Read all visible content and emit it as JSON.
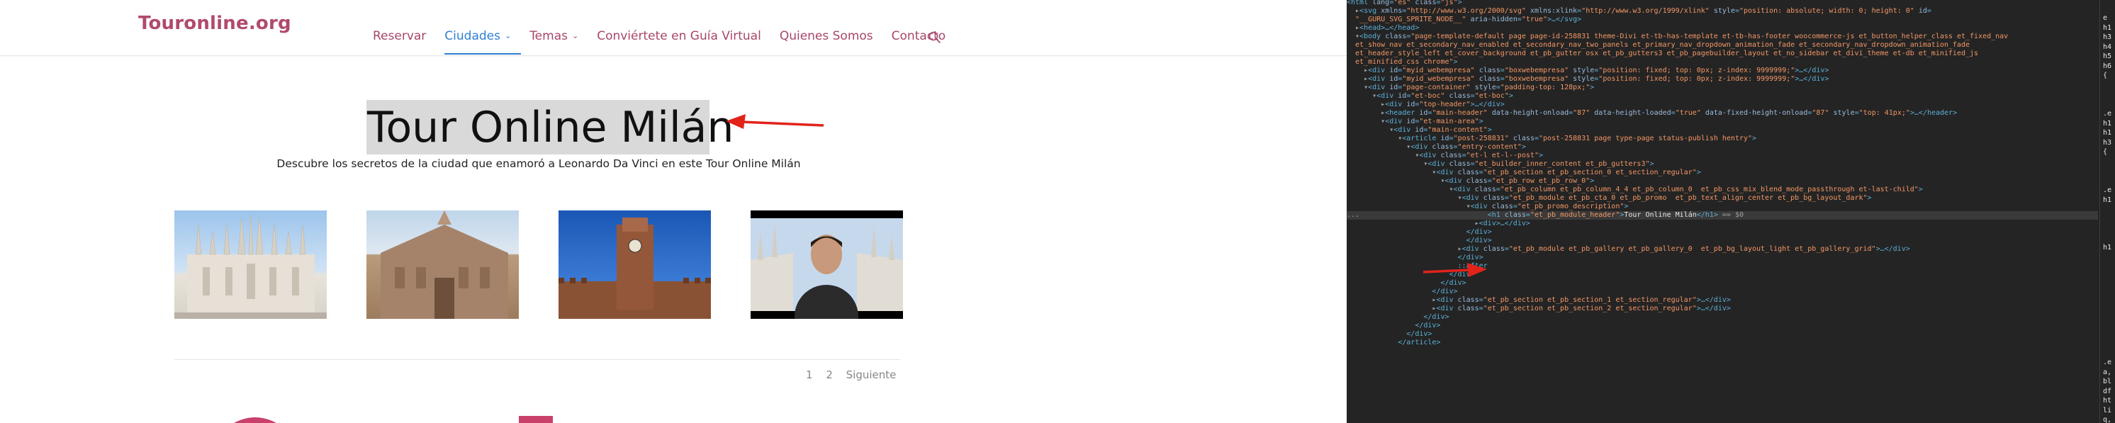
{
  "site": {
    "logo": "Touronline.org",
    "nav": [
      {
        "label": "Reservar",
        "dropdown": false
      },
      {
        "label": "Ciudades",
        "dropdown": true,
        "active": true
      },
      {
        "label": "Temas",
        "dropdown": true
      },
      {
        "label": "Conviértete en Guía Virtual",
        "dropdown": false
      },
      {
        "label": "Quienes Somos",
        "dropdown": false
      },
      {
        "label": "Contacto",
        "dropdown": false
      }
    ],
    "caret": "⌄",
    "hero_title": "Tour Online Milán",
    "hero_subtitle": "Descubre los secretos de la ciudad que enamoró a Leonardo Da Vinci en este Tour Online Milán",
    "pagination": {
      "pages": [
        "1",
        "2"
      ],
      "next": "Siguiente"
    },
    "colors": {
      "brand": "#b04a6e",
      "nav_active": "#2f7fd3",
      "arrow": "#e2231a"
    }
  },
  "devtools": {
    "lines": [
      [
        [
          "t",
          "<html "
        ],
        [
          "a",
          "lang"
        ],
        [
          "t",
          "="
        ],
        [
          "v",
          "\"es\""
        ],
        [
          "t",
          " "
        ],
        [
          "a",
          "class"
        ],
        [
          "t",
          "="
        ],
        [
          "v",
          "\"js\""
        ],
        [
          "t",
          ">"
        ]
      ],
      [
        [
          "r",
          "  ▸"
        ],
        [
          "t",
          "<svg "
        ],
        [
          "a",
          "xmlns"
        ],
        [
          "t",
          "="
        ],
        [
          "v",
          "\"http://www.w3.org/2000/svg\""
        ],
        [
          "t",
          " "
        ],
        [
          "a",
          "xmlns:xlink"
        ],
        [
          "t",
          "="
        ],
        [
          "v",
          "\"http://www.w3.org/1999/xlink\""
        ],
        [
          "t",
          " "
        ],
        [
          "a",
          "style"
        ],
        [
          "t",
          "="
        ],
        [
          "v",
          "\"position: absolute; width: 0; height: 0\""
        ],
        [
          "t",
          " "
        ],
        [
          "a",
          "id"
        ],
        [
          "t",
          "="
        ]
      ],
      [
        [
          "t",
          "  "
        ],
        [
          "v",
          "\"__GURU_SVG_SPRITE_NODE__\""
        ],
        [
          "t",
          " "
        ],
        [
          "a",
          "aria-hidden"
        ],
        [
          "t",
          "="
        ],
        [
          "v",
          "\"true\""
        ],
        [
          "t",
          ">…</svg>"
        ]
      ],
      [
        [
          "r",
          "  ▸"
        ],
        [
          "t",
          "<head>…</head>"
        ]
      ],
      [
        [
          "r",
          "  ▾"
        ],
        [
          "t",
          "<body "
        ],
        [
          "a",
          "class"
        ],
        [
          "t",
          "="
        ],
        [
          "v",
          "\"page-template-default page page-id-258831 theme-Divi et-tb-has-template et-tb-has-footer woocommerce-js et_button_helper_class et_fixed_nav"
        ]
      ],
      [
        [
          "v",
          "  et_show_nav et_secondary_nav_enabled et_secondary_nav_two_panels et_primary_nav_dropdown_animation_fade et_secondary_nav_dropdown_animation_fade"
        ]
      ],
      [
        [
          "v",
          "  et_header_style_left et_cover_background et_pb_gutter osx et_pb_gutters3 et_pb_pagebuilder_layout et_no_sidebar et_divi_theme et-db et_minified_js"
        ]
      ],
      [
        [
          "v",
          "  et_minified_css chrome\""
        ],
        [
          "t",
          ">"
        ]
      ],
      [
        [
          "r",
          "    ▸"
        ],
        [
          "t",
          "<div "
        ],
        [
          "a",
          "id"
        ],
        [
          "t",
          "="
        ],
        [
          "v",
          "\"myid_webempresa\""
        ],
        [
          "t",
          " "
        ],
        [
          "a",
          "class"
        ],
        [
          "t",
          "="
        ],
        [
          "v",
          "\"boxwebempresa\""
        ],
        [
          "t",
          " "
        ],
        [
          "a",
          "style"
        ],
        [
          "t",
          "="
        ],
        [
          "v",
          "\"position: fixed; top: 0px; z-index: 9999999;\""
        ],
        [
          "t",
          ">…</div>"
        ]
      ],
      [
        [
          "r",
          "    ▸"
        ],
        [
          "t",
          "<div "
        ],
        [
          "a",
          "id"
        ],
        [
          "t",
          "="
        ],
        [
          "v",
          "\"myid_webempresa\""
        ],
        [
          "t",
          " "
        ],
        [
          "a",
          "class"
        ],
        [
          "t",
          "="
        ],
        [
          "v",
          "\"boxwebempresa\""
        ],
        [
          "t",
          " "
        ],
        [
          "a",
          "style"
        ],
        [
          "t",
          "="
        ],
        [
          "v",
          "\"position: fixed; top: 0px; z-index: 9999999;\""
        ],
        [
          "t",
          ">…</div>"
        ]
      ],
      [
        [
          "r",
          "    ▾"
        ],
        [
          "t",
          "<div "
        ],
        [
          "a",
          "id"
        ],
        [
          "t",
          "="
        ],
        [
          "v",
          "\"page-container\""
        ],
        [
          "t",
          " "
        ],
        [
          "a",
          "style"
        ],
        [
          "t",
          "="
        ],
        [
          "v",
          "\"padding-top: 128px;\""
        ],
        [
          "t",
          ">"
        ]
      ],
      [
        [
          "r",
          "      ▾"
        ],
        [
          "t",
          "<div "
        ],
        [
          "a",
          "id"
        ],
        [
          "t",
          "="
        ],
        [
          "v",
          "\"et-boc\""
        ],
        [
          "t",
          " "
        ],
        [
          "a",
          "class"
        ],
        [
          "t",
          "="
        ],
        [
          "v",
          "\"et-boc\""
        ],
        [
          "t",
          ">"
        ]
      ],
      [
        [
          "r",
          "        ▸"
        ],
        [
          "t",
          "<div "
        ],
        [
          "a",
          "id"
        ],
        [
          "t",
          "="
        ],
        [
          "v",
          "\"top-header\""
        ],
        [
          "t",
          ">…</div>"
        ]
      ],
      [
        [
          "r",
          "        ▸"
        ],
        [
          "t",
          "<header "
        ],
        [
          "a",
          "id"
        ],
        [
          "t",
          "="
        ],
        [
          "v",
          "\"main-header\""
        ],
        [
          "t",
          " "
        ],
        [
          "a",
          "data-height-onload"
        ],
        [
          "t",
          "="
        ],
        [
          "v",
          "\"87\""
        ],
        [
          "t",
          " "
        ],
        [
          "a",
          "data-height-loaded"
        ],
        [
          "t",
          "="
        ],
        [
          "v",
          "\"true\""
        ],
        [
          "t",
          " "
        ],
        [
          "a",
          "data-fixed-height-onload"
        ],
        [
          "t",
          "="
        ],
        [
          "v",
          "\"87\""
        ],
        [
          "t",
          " "
        ],
        [
          "a",
          "style"
        ],
        [
          "t",
          "="
        ],
        [
          "v",
          "\"top: 41px;\""
        ],
        [
          "t",
          ">…</header>"
        ]
      ],
      [
        [
          "r",
          "        ▾"
        ],
        [
          "t",
          "<div "
        ],
        [
          "a",
          "id"
        ],
        [
          "t",
          "="
        ],
        [
          "v",
          "\"et-main-area\""
        ],
        [
          "t",
          ">"
        ]
      ],
      [
        [
          "r",
          "          ▾"
        ],
        [
          "t",
          "<div "
        ],
        [
          "a",
          "id"
        ],
        [
          "t",
          "="
        ],
        [
          "v",
          "\"main-content\""
        ],
        [
          "t",
          ">"
        ]
      ],
      [
        [
          "r",
          "            ▾"
        ],
        [
          "t",
          "<article "
        ],
        [
          "a",
          "id"
        ],
        [
          "t",
          "="
        ],
        [
          "v",
          "\"post-258831\""
        ],
        [
          "t",
          " "
        ],
        [
          "a",
          "class"
        ],
        [
          "t",
          "="
        ],
        [
          "v",
          "\"post-258831 page type-page status-publish hentry\""
        ],
        [
          "t",
          ">"
        ]
      ],
      [
        [
          "r",
          "              ▾"
        ],
        [
          "t",
          "<div "
        ],
        [
          "a",
          "class"
        ],
        [
          "t",
          "="
        ],
        [
          "v",
          "\"entry-content\""
        ],
        [
          "t",
          ">"
        ]
      ],
      [
        [
          "r",
          "                ▾"
        ],
        [
          "t",
          "<div "
        ],
        [
          "a",
          "class"
        ],
        [
          "t",
          "="
        ],
        [
          "v",
          "\"et-l et-l--post\""
        ],
        [
          "t",
          ">"
        ]
      ],
      [
        [
          "r",
          "                  ▾"
        ],
        [
          "t",
          "<div "
        ],
        [
          "a",
          "class"
        ],
        [
          "t",
          "="
        ],
        [
          "v",
          "\"et_builder_inner_content et_pb_gutters3\""
        ],
        [
          "t",
          ">"
        ]
      ],
      [
        [
          "r",
          "                    ▾"
        ],
        [
          "t",
          "<div "
        ],
        [
          "a",
          "class"
        ],
        [
          "t",
          "="
        ],
        [
          "v",
          "\"et_pb_section et_pb_section_0 et_section_regular\""
        ],
        [
          "t",
          ">"
        ]
      ],
      [
        [
          "r",
          "                      ▾"
        ],
        [
          "t",
          "<div "
        ],
        [
          "a",
          "class"
        ],
        [
          "t",
          "="
        ],
        [
          "v",
          "\"et_pb_row et_pb_row_0\""
        ],
        [
          "t",
          ">"
        ]
      ],
      [
        [
          "r",
          "                        ▾"
        ],
        [
          "t",
          "<div "
        ],
        [
          "a",
          "class"
        ],
        [
          "t",
          "="
        ],
        [
          "v",
          "\"et_pb_column et_pb_column_4_4 et_pb_column_0  et_pb_css_mix_blend_mode_passthrough et-last-child\""
        ],
        [
          "t",
          ">"
        ]
      ],
      [
        [
          "r",
          "                          ▾"
        ],
        [
          "t",
          "<div "
        ],
        [
          "a",
          "class"
        ],
        [
          "t",
          "="
        ],
        [
          "v",
          "\"et_pb_module et_pb_cta_0 et_pb_promo  et_pb_text_align_center et_pb_bg_layout_dark\""
        ],
        [
          "t",
          ">"
        ]
      ],
      [
        [
          "r",
          "                            ▾"
        ],
        [
          "t",
          "<div "
        ],
        [
          "a",
          "class"
        ],
        [
          "t",
          "="
        ],
        [
          "v",
          "\"et_pb_promo_description\""
        ],
        [
          "t",
          ">"
        ]
      ],
      [
        [
          "r",
          "...                              "
        ],
        [
          "t",
          "<h1 "
        ],
        [
          "a",
          "class"
        ],
        [
          "t",
          "="
        ],
        [
          "v",
          "\"et_pb_module_header\""
        ],
        [
          "t",
          ">"
        ],
        [
          "x",
          "Tour Online Milán"
        ],
        [
          "t",
          "</h1>"
        ],
        [
          "r",
          " == $0"
        ]
      ],
      [
        [
          "r",
          "                              ▸"
        ],
        [
          "t",
          "<div>…</div>"
        ]
      ],
      [
        [
          "t",
          "                            </div>"
        ]
      ],
      [
        [
          "t",
          "                            </div>"
        ]
      ],
      [
        [
          "r",
          "                          ▸"
        ],
        [
          "t",
          "<div "
        ],
        [
          "a",
          "class"
        ],
        [
          "t",
          "="
        ],
        [
          "v",
          "\"et_pb_module et_pb_gallery et_pb_gallery_0  et_pb_bg_layout_light et_pb_gallery_grid\""
        ],
        [
          "t",
          ">…</div>"
        ]
      ],
      [
        [
          "t",
          "                          </div>"
        ]
      ],
      [
        [
          "t",
          "                          ::after"
        ]
      ],
      [
        [
          "t",
          "                        </div>"
        ]
      ],
      [
        [
          "t",
          "                      </div>"
        ]
      ],
      [
        [
          "t",
          "                    </div>"
        ]
      ],
      [
        [
          "r",
          "                    ▸"
        ],
        [
          "t",
          "<div "
        ],
        [
          "a",
          "class"
        ],
        [
          "t",
          "="
        ],
        [
          "v",
          "\"et_pb_section et_pb_section_1 et_section_regular\""
        ],
        [
          "t",
          ">…</div>"
        ]
      ],
      [
        [
          "r",
          "                    ▸"
        ],
        [
          "t",
          "<div "
        ],
        [
          "a",
          "class"
        ],
        [
          "t",
          "="
        ],
        [
          "v",
          "\"et_pb_section et_pb_section_2 et_section_regular\""
        ],
        [
          "t",
          ">…</div>"
        ]
      ],
      [
        [
          "t",
          "                  </div>"
        ]
      ],
      [
        [
          "t",
          "                </div>"
        ]
      ],
      [
        [
          "t",
          "              </div>"
        ]
      ],
      [
        [
          "t",
          "            </article>"
        ]
      ]
    ],
    "selected_line": 25,
    "styles_fragments": [
      "e",
      "h1",
      "h3",
      "h4",
      "h5",
      "h6",
      "{",
      "",
      "",
      "",
      ".e",
      "h1",
      "h1",
      "h3",
      "{",
      "",
      "",
      "",
      ".e",
      "h1",
      "",
      "",
      "",
      "",
      "h1",
      "",
      "",
      "",
      "",
      "",
      "",
      "",
      "",
      "",
      "",
      "",
      ".e",
      "a,",
      "bl",
      "df",
      "ht",
      "li",
      "q,",
      "s"
    ]
  }
}
